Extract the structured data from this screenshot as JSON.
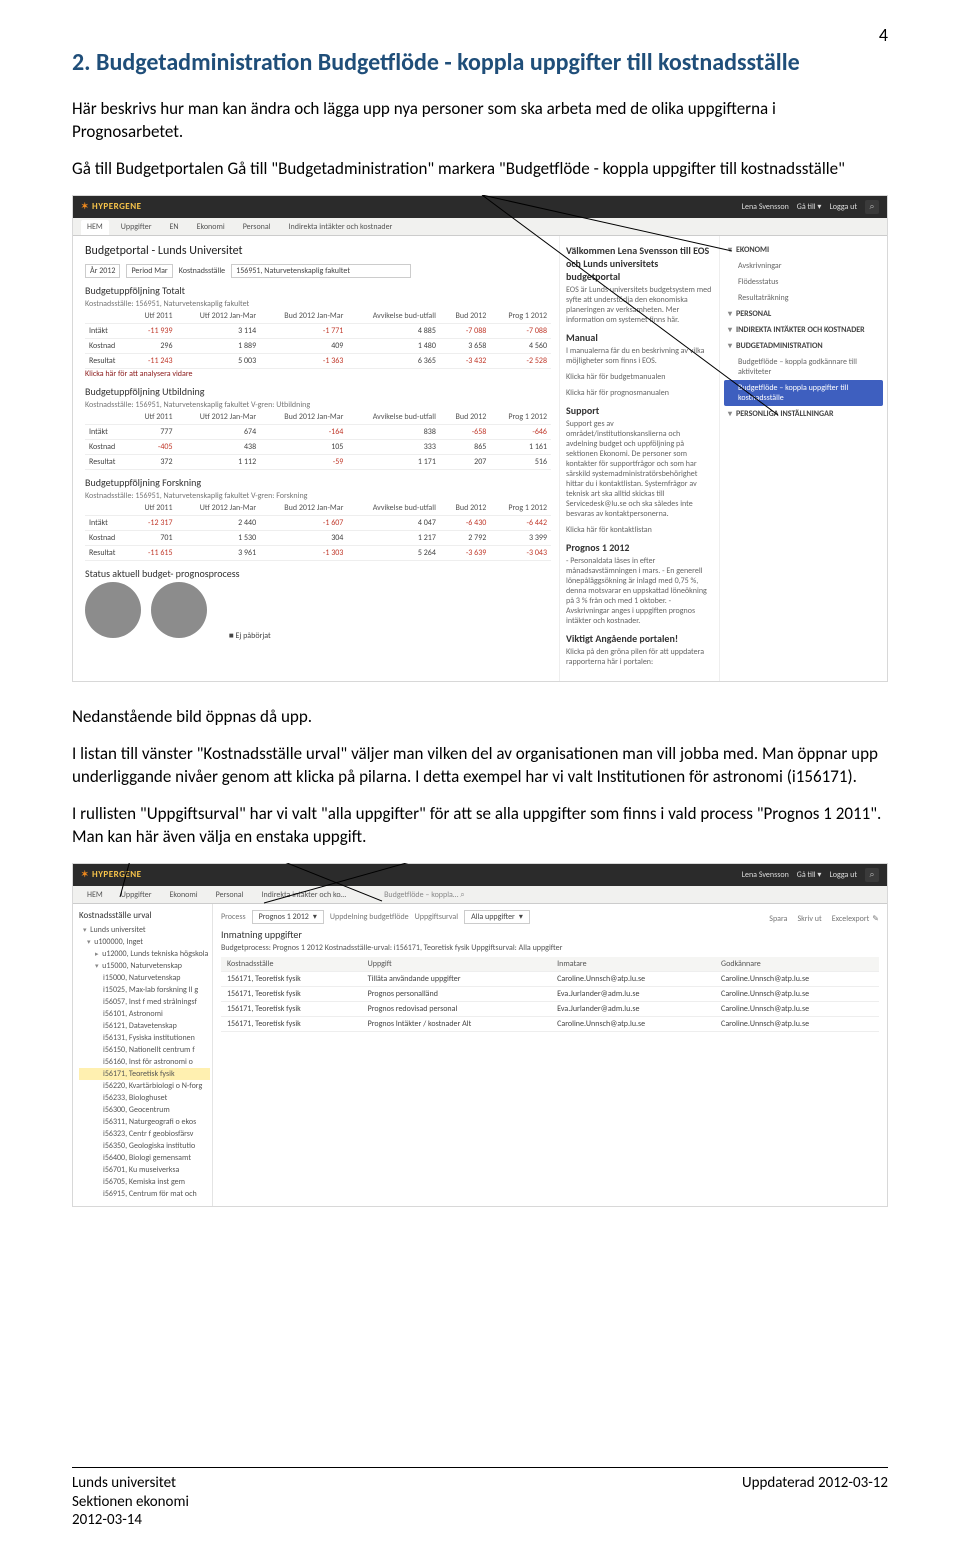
{
  "page_number": "4",
  "heading": "2. Budgetadministration Budgetflöde - koppla uppgifter till kostnadsställe",
  "para1": "Här beskrivs hur man kan ändra och lägga upp nya personer som ska arbeta med de olika uppgifterna i Prognosarbetet.",
  "para2": "Gå till Budgetportalen Gå till \"Budgetadministration\" markera \"Budgetflöde - koppla uppgifter till kostnadsställe\"",
  "para3": "Nedanstående bild öppnas då upp.",
  "para4": "I listan till vänster \"Kostnadsställe urval\" väljer man vilken del av organisationen man vill jobba med. Man öppnar upp underliggande nivåer genom att klicka på pilarna. I detta exempel har vi valt Institutionen för astronomi (i156171).",
  "para5": "I rullisten \"Uppgiftsurval\" har vi valt \"alla uppgifter\" för att se alla uppgifter som finns i vald process \"Prognos 1 2011\". Man kan här även välja en enstaka uppgift.",
  "s1": {
    "brand": "HYPERGENE",
    "topright_user": "Lena Svensson",
    "topright_goto": "Gå till ▾",
    "topright_logout": "Logga ut",
    "tabs": [
      "HEM",
      "Uppgifter",
      "EN",
      "Ekonomi",
      "Personal",
      "Indirekta intäkter och kostnader"
    ],
    "left": {
      "title": "Budgetportal - Lunds Universitet",
      "sel_year": "År 2012",
      "sel_period": "Period Mar",
      "sel_kst_label": "Kostnadsställe",
      "sel_kst_value": "156951, Naturvetenskaplig fakultet",
      "block1_title": "Budgetuppföljning Totalt",
      "block1_sub": "Kostnadsställe: 156951, Naturvetenskaplig fakultet",
      "cols": [
        "",
        "Utf 2011",
        "Utf 2012 Jan-Mar",
        "Bud 2012 Jan-Mar",
        "Avvikelse bud-utfall",
        "Bud 2012",
        "Prog 1 2012"
      ],
      "t1": [
        [
          "Intäkt",
          "-11 939",
          "3 114",
          "-1 771",
          "4 885",
          "-7 088",
          "-7 088"
        ],
        [
          "Kostnad",
          "296",
          "1 889",
          "409",
          "1 480",
          "3 658",
          "4 560"
        ],
        [
          "Resultat",
          "-11 243",
          "5 003",
          "-1 363",
          "6 365",
          "-3 432",
          "-2 528"
        ]
      ],
      "link1": "Klicka här för att analysera vidare",
      "block2_title": "Budgetuppföljning Utbildning",
      "block2_sub": "Kostnadsställe: 156951, Naturvetenskaplig fakultet    V-gren: Utbildning",
      "t2": [
        [
          "Intäkt",
          "777",
          "674",
          "-164",
          "838",
          "-658",
          "-646"
        ],
        [
          "Kostnad",
          "-405",
          "438",
          "105",
          "333",
          "865",
          "1 161"
        ],
        [
          "Resultat",
          "372",
          "1 112",
          "-59",
          "1 171",
          "207",
          "516"
        ]
      ],
      "block3_title": "Budgetuppföljning Forskning",
      "block3_sub": "Kostnadsställe: 156951, Naturvetenskaplig fakultet    V-gren: Forskning",
      "t3": [
        [
          "Intäkt",
          "-12 317",
          "2 440",
          "-1 607",
          "4 047",
          "-6 430",
          "-6 442"
        ],
        [
          "Kostnad",
          "701",
          "1 530",
          "304",
          "1 217",
          "2 792",
          "3 399"
        ],
        [
          "Resultat",
          "-11 615",
          "3 961",
          "-1 303",
          "5 264",
          "-3 639",
          "-3 043"
        ]
      ],
      "status_title": "Status aktuell budget- prognosprocess",
      "status_legend": "Ej påbörjat"
    },
    "mid": {
      "h1": "Välkommen Lena Svensson till EOS och Lunds universitets budgetportal",
      "p1": "EOS är Lunds universitets budgetsystem med syfte att understödja den ekonomiska planeringen av verksamheten. Mer information om systemet finns här.",
      "h2": "Manual",
      "p2": "I manualerna får du en beskrivning av vilka möjligheter som finns i EOS.",
      "l1": "Klicka här för budgetmanualen",
      "l2": "Klicka här för prognosmanualen",
      "h3": "Support",
      "p3": "Support ges av området/institutionskanslierna och avdelning budget och uppföljning på sektionen Ekonomi. De personer som kontakter för supportfrågor och som har särskild systemadministratörsbehörighet hittar du i kontaktlistan. Systemfrågor av teknisk art ska alltid skickas till Servicedesk@lu.se och ska således inte besvaras av kontaktpersonerna.",
      "l3": "Klicka här för kontaktlistan",
      "h4": "Prognos 1 2012",
      "p4": "- Personaldata låses in efter månadsavstämningen i mars.\n- En generell lönepåläggsökning är inlagd med 0,75 %, denna motsvarar en uppskattad löneökning på 3 % från och med 1 oktober.\n- Avskrivningar anges i uppgiften prognos intäkter och kostnader.",
      "h5": "Viktigt Angående portalen!",
      "p5": "Klicka på den gröna pilen för att uppdatera rapporterna här i portalen:"
    },
    "right": {
      "items": [
        {
          "type": "cat",
          "label": "EKONOMI"
        },
        {
          "type": "sub",
          "label": "Avskrivningar"
        },
        {
          "type": "sub",
          "label": "Flödesstatus"
        },
        {
          "type": "sub",
          "label": "Resultaträkning"
        },
        {
          "type": "cat",
          "label": "PERSONAL"
        },
        {
          "type": "cat",
          "label": "INDIREKTA INTÄKTER OCH KOSTNADER"
        },
        {
          "type": "cat",
          "label": "BUDGETADMINISTRATION"
        },
        {
          "type": "sub",
          "label": "Budgetflöde – koppla godkännare till aktiviteter"
        },
        {
          "type": "sel",
          "label": "Budgetflöde – koppla uppgifter till kostnadsställe"
        },
        {
          "type": "cat",
          "label": "PERSONLIGA INSTÄLLNINGAR"
        }
      ]
    }
  },
  "s2": {
    "brand": "HYPERGENE",
    "topright_user": "Lena Svensson",
    "topright_goto": "Gå till ▾",
    "topright_logout": "Logga ut",
    "tabs": [
      "HEM",
      "Uppgifter",
      "Ekonomi",
      "Personal",
      "Indirekta intäkter och ko…"
    ],
    "crumb": "Budgetflöde – koppla…",
    "tree_title": "Kostnadsställe urval",
    "tree": [
      {
        "lvl": 0,
        "label": "Lunds universitet",
        "expanded": true
      },
      {
        "lvl": 1,
        "label": "u100000, Inget",
        "expanded": true
      },
      {
        "lvl": 2,
        "label": "u12000, Lunds tekniska högskola",
        "expanded": false
      },
      {
        "lvl": 2,
        "label": "u15000, Naturvetenskap",
        "expanded": true
      },
      {
        "lvl": 3,
        "label": "i15000, Naturvetenskap"
      },
      {
        "lvl": 3,
        "label": "i15025, Max-lab forskning II g"
      },
      {
        "lvl": 3,
        "label": "i56057, Inst f med strålningsf"
      },
      {
        "lvl": 3,
        "label": "i56101, Astronomi"
      },
      {
        "lvl": 3,
        "label": "i56121, Datavetenskap"
      },
      {
        "lvl": 3,
        "label": "i56131, Fysiska institutionen"
      },
      {
        "lvl": 3,
        "label": "i56150, Nationellt centrum f"
      },
      {
        "lvl": 3,
        "label": "i56160, Inst för astronomi o"
      },
      {
        "lvl": 3,
        "label": "i56171, Teoretisk fysik",
        "sel": true
      },
      {
        "lvl": 3,
        "label": "i56220, Kvartärbiologi o N-forg"
      },
      {
        "lvl": 3,
        "label": "i56233, Biologhuset"
      },
      {
        "lvl": 3,
        "label": "i56300, Geocentrum"
      },
      {
        "lvl": 3,
        "label": "i56311, Naturgeografi o ekos"
      },
      {
        "lvl": 3,
        "label": "i56323, Centr f geobiosfärsv"
      },
      {
        "lvl": 3,
        "label": "i56350, Geologiska institutio"
      },
      {
        "lvl": 3,
        "label": "i56400, Biologi gemensamt"
      },
      {
        "lvl": 3,
        "label": "i56701, Ku museiverksa"
      },
      {
        "lvl": 3,
        "label": "i56705, Kemiska inst gem"
      },
      {
        "lvl": 3,
        "label": "i56915, Centrum för mat och"
      }
    ],
    "sel_process_lbl": "Process",
    "sel_process": "Prognos 1 2012",
    "sel_uppdel_lbl": "Uppdelning budgetflöde",
    "sel_urval_lbl": "Uppgiftsurval",
    "sel_urval": "Alla uppgifter",
    "panel_title": "Inmatning uppgifter",
    "proc_line": "Budgetprocess: Prognos 1 2012 Kostnadsställe-urval: i156171, Teoretisk fysik Uppgiftsurval: Alla uppgifter",
    "btn_save": "Spara",
    "btn_print": "Skriv ut",
    "btn_export": "Excelexport",
    "thead": [
      "Kostnadsställe",
      "Uppgift",
      "Inmatare",
      "Godkännare"
    ],
    "rows": [
      [
        "156171, Teoretisk fysik",
        "Tilläta användande uppgifter",
        "Caroline.Unnsch@atp.lu.se",
        "Caroline.Unnsch@atp.lu.se"
      ],
      [
        "156171, Teoretisk fysik",
        "Prognos personalländ",
        "Eva.Jurlander@adm.lu.se",
        "Caroline.Unnsch@atp.lu.se"
      ],
      [
        "156171, Teoretisk fysik",
        "Prognos redovisad personal",
        "Eva.Jurlander@adm.lu.se",
        "Caroline.Unnsch@atp.lu.se"
      ],
      [
        "156171, Teoretisk fysik",
        "Prognos Intäkter / kostnader Alt",
        "Caroline.Unnsch@atp.lu.se",
        "Caroline.Unnsch@atp.lu.se"
      ]
    ]
  },
  "footer_left1": "Lunds universitet",
  "footer_left2": "Sektionen ekonomi",
  "footer_left3": "2012-03-14",
  "footer_right": "Uppdaterad 2012-03-12"
}
